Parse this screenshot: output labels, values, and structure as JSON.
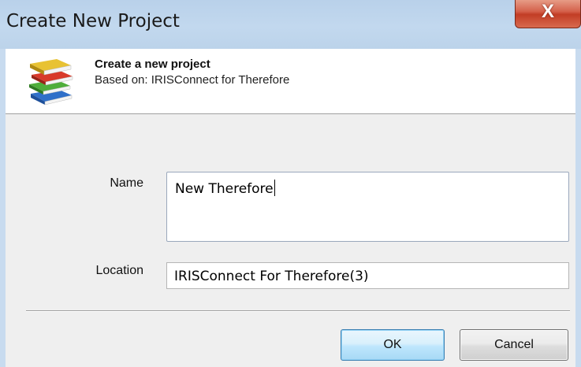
{
  "window": {
    "title": "Create New Project",
    "close_glyph": "X"
  },
  "header": {
    "title": "Create a new project",
    "subtitle": "Based on: IRISConnect for Therefore",
    "icon": "books-icon"
  },
  "form": {
    "name_label": "Name",
    "name_value": "New Therefore",
    "location_label": "Location",
    "location_value": "IRISConnect For Therefore(3)"
  },
  "buttons": {
    "ok_label": "OK",
    "cancel_label": "Cancel"
  },
  "colors": {
    "titlebar": "#c2d8ee",
    "close_button": "#c23d25",
    "ok_border": "#3c7fb1",
    "body_background": "#efefef"
  }
}
